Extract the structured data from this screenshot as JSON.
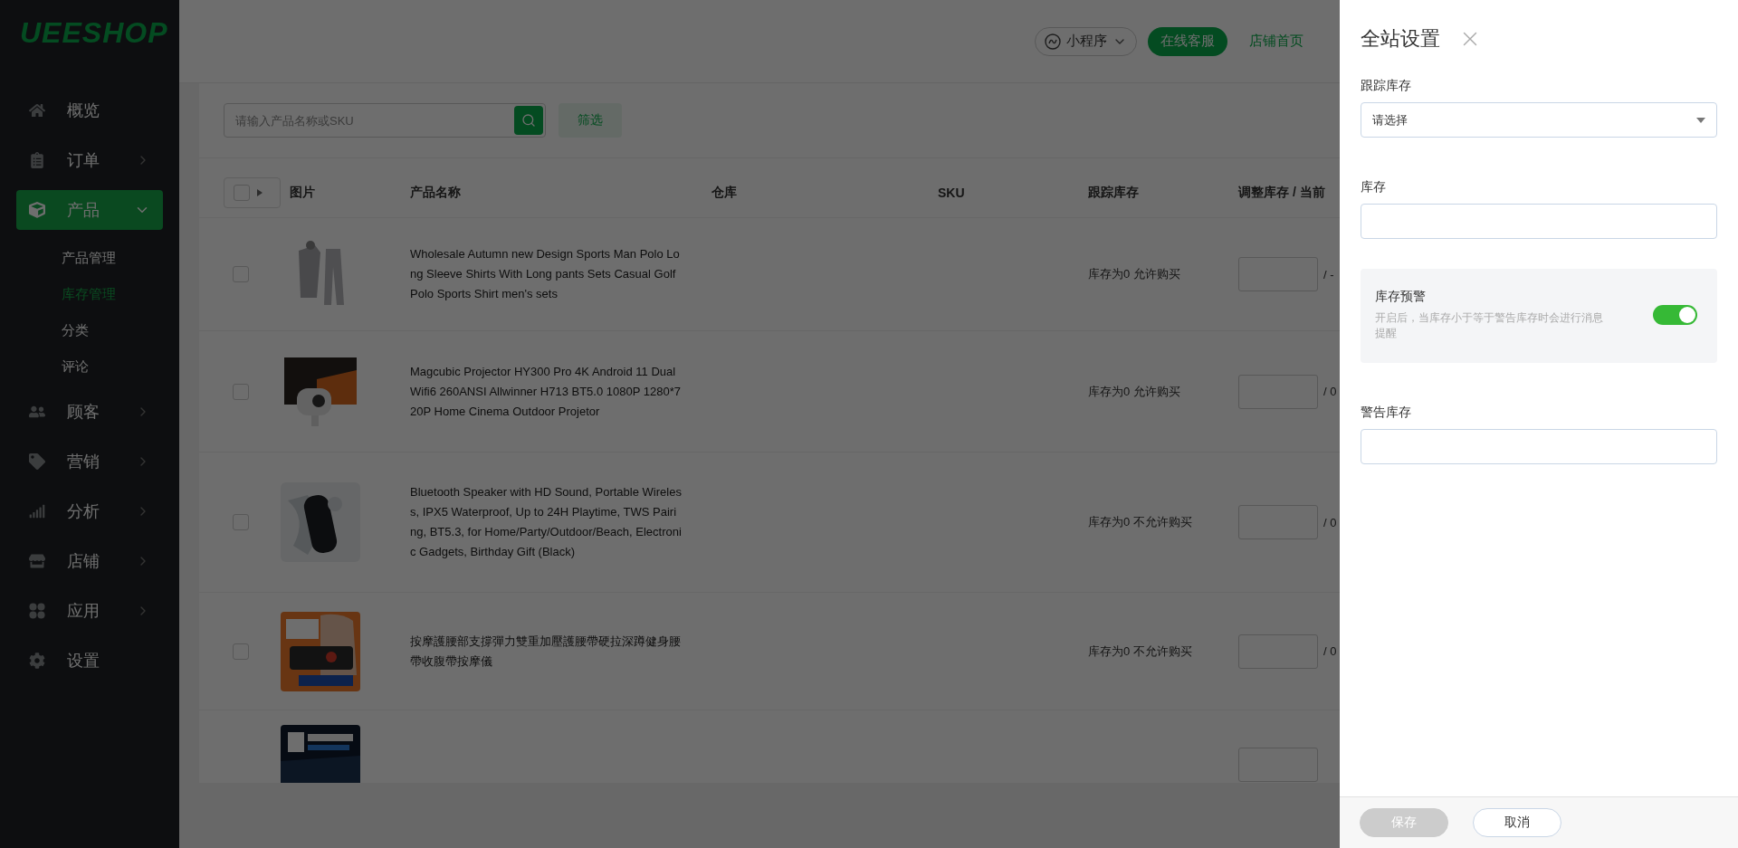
{
  "logo": "UEESHOP",
  "sidebar": {
    "items": [
      {
        "label": "概览",
        "kind": "link",
        "selected": false,
        "expanded": false
      },
      {
        "label": "订单",
        "kind": "group",
        "selected": false,
        "expanded": false
      },
      {
        "label": "产品",
        "kind": "group",
        "selected": true,
        "expanded": true,
        "children": [
          {
            "label": "产品管理",
            "selected": false
          },
          {
            "label": "库存管理",
            "selected": true
          },
          {
            "label": "分类",
            "selected": false
          },
          {
            "label": "评论",
            "selected": false
          }
        ]
      },
      {
        "label": "顾客",
        "kind": "group",
        "selected": false,
        "expanded": false
      },
      {
        "label": "营销",
        "kind": "group",
        "selected": false,
        "expanded": false
      },
      {
        "label": "分析",
        "kind": "group",
        "selected": false,
        "expanded": false
      },
      {
        "label": "店铺",
        "kind": "group",
        "selected": false,
        "expanded": false
      },
      {
        "label": "应用",
        "kind": "group",
        "selected": false,
        "expanded": false
      },
      {
        "label": "设置",
        "kind": "link",
        "selected": false,
        "expanded": false
      }
    ]
  },
  "header": {
    "mini_program": "小程序",
    "service_button": "在线客服",
    "store_link": "店铺首页"
  },
  "toolbar": {
    "search": {
      "placeholder": "请输入产品名称或SKU"
    },
    "filter_button": "筛选"
  },
  "table": {
    "select_all": {
      "checked": false
    },
    "columns": [
      "图片",
      "产品名称",
      "仓库",
      "SKU",
      "跟踪库存",
      "调整库存 / 当前"
    ],
    "rows": [
      {
        "checked": false,
        "image": {
          "kind": "picture"
        },
        "name": "Wholesale Autumn new Design Sports Man Polo Long Sleeve Shirts With Long pants Sets Casual Golf Polo Sports Shirt men's sets",
        "tracking": "库存为0 允许购买",
        "current": "/ -"
      },
      {
        "checked": false,
        "image": {
          "kind": "picture"
        },
        "name": "Magcubic Projector HY300 Pro 4K Android 11 Dual Wifi6 260ANSI Allwinner H713 BT5.0 1080P 1280*720P Home Cinema Outdoor Projetor",
        "tracking": "库存为0 允许购买",
        "current": "/ 0"
      },
      {
        "checked": false,
        "image": {
          "kind": "picture"
        },
        "name": "Bluetooth Speaker with HD Sound, Portable Wireless, IPX5 Waterproof, Up to 24H Playtime, TWS Pairing, BT5.3, for Home/Party/Outdoor/Beach, Electronic Gadgets, Birthday Gift (Black)",
        "tracking": "库存为0 不允许购买",
        "current": "/ 0"
      },
      {
        "checked": false,
        "image": {
          "kind": "picture"
        },
        "name": "按摩護腰部支撐彈力雙重加壓護腰帶硬拉深蹲健身腰帶收腹帶按摩儀",
        "tracking": "库存为0 不允许购买",
        "current": "/ 0"
      },
      {
        "image": {
          "kind": "picture"
        }
      }
    ]
  },
  "drawer": {
    "title": "全站设置",
    "fields": [
      {
        "label": "跟踪库存",
        "kind": "select",
        "placeholder": "请选择"
      },
      {
        "label": "库存",
        "kind": "input"
      }
    ],
    "alert": {
      "title": "库存预警",
      "description": "开启后，当库存小于等于警告库存时会进行消息提醒",
      "on": true
    },
    "warning_field": {
      "label": "警告库存",
      "kind": "input"
    },
    "buttons": [
      {
        "label": "保存",
        "disabled": true
      },
      {
        "label": "取消",
        "disabled": false
      }
    ]
  }
}
